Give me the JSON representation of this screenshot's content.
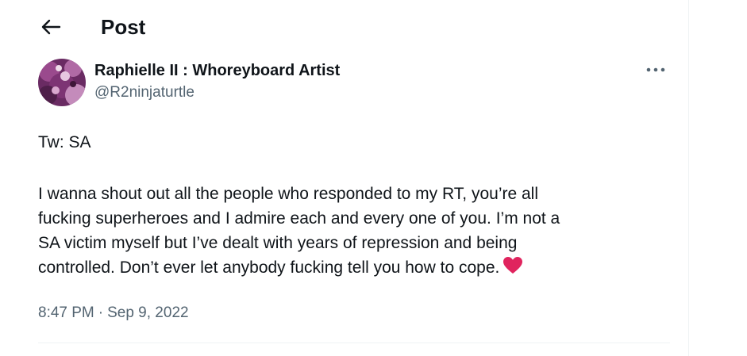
{
  "header": {
    "title": "Post",
    "back_icon": "arrow-left-icon"
  },
  "author": {
    "display_name": "Raphielle II : Whoreyboard Artist",
    "handle": "@R2ninjaturtle",
    "avatar_icon": "avatar-image"
  },
  "more_icon": "more-horizontal-icon",
  "tweet": {
    "line1": "Tw: SA",
    "body_lines": [
      "I wanna shout out all the people who responded to my RT, you’re all",
      "fucking superheroes and I admire each and every one of you. I’m not a",
      "SA victim myself but I’ve dealt with years of repression and being",
      "controlled. Don’t ever let anybody fucking tell you how to cope."
    ],
    "emoji": "red-heart-icon"
  },
  "meta": {
    "time": "8:47 PM",
    "separator": "·",
    "date": "Sep 9, 2022"
  },
  "colors": {
    "text": "#0f1419",
    "secondary": "#536471",
    "heart": "#e0245e",
    "divider": "#eff3f4"
  }
}
